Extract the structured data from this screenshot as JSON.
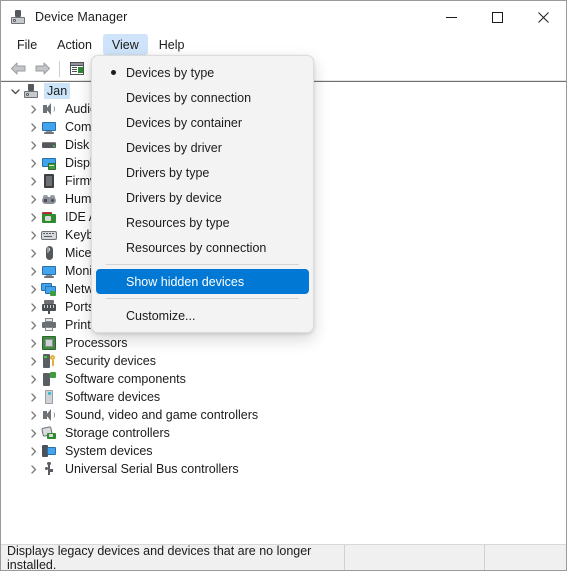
{
  "window": {
    "title": "Device Manager",
    "icon": "device-manager-icon",
    "controls": {
      "minimize": "minimize-icon",
      "maximize": "maximize-icon",
      "close": "close-icon"
    }
  },
  "menubar": {
    "items": [
      {
        "label": "File",
        "active": false
      },
      {
        "label": "Action",
        "active": false
      },
      {
        "label": "View",
        "active": true
      },
      {
        "label": "Help",
        "active": false
      }
    ]
  },
  "toolbar": {
    "buttons": [
      {
        "name": "back-arrow-icon",
        "enabled": false
      },
      {
        "name": "forward-arrow-icon",
        "enabled": false
      },
      {
        "name": "properties-icon",
        "enabled": true
      }
    ]
  },
  "view_menu": {
    "items": [
      {
        "label": "Devices by type",
        "checked": true,
        "highlight": false,
        "separator_after": false
      },
      {
        "label": "Devices by connection",
        "checked": false,
        "highlight": false,
        "separator_after": false
      },
      {
        "label": "Devices by container",
        "checked": false,
        "highlight": false,
        "separator_after": false
      },
      {
        "label": "Devices by driver",
        "checked": false,
        "highlight": false,
        "separator_after": false
      },
      {
        "label": "Drivers by type",
        "checked": false,
        "highlight": false,
        "separator_after": false
      },
      {
        "label": "Drivers by device",
        "checked": false,
        "highlight": false,
        "separator_after": false
      },
      {
        "label": "Resources by type",
        "checked": false,
        "highlight": false,
        "separator_after": false
      },
      {
        "label": "Resources by connection",
        "checked": false,
        "highlight": false,
        "separator_after": true
      },
      {
        "label": "Show hidden devices",
        "checked": false,
        "highlight": true,
        "separator_after": true
      },
      {
        "label": "Customize...",
        "checked": false,
        "highlight": false,
        "separator_after": false
      }
    ]
  },
  "tree": {
    "root": {
      "label": "Jan",
      "icon": "computer-icon",
      "expanded": true,
      "selected": true
    },
    "nodes": [
      {
        "label": "Audio inputs and outputs",
        "icon": "speaker-icon"
      },
      {
        "label": "Computer",
        "icon": "monitor-icon"
      },
      {
        "label": "Disk drives",
        "icon": "disk-drive-icon"
      },
      {
        "label": "Display adapters",
        "icon": "display-adapter-icon"
      },
      {
        "label": "Firmware",
        "icon": "firmware-chip-icon"
      },
      {
        "label": "Human Interface Devices",
        "icon": "gamepad-icon"
      },
      {
        "label": "IDE ATA/ATAPI controllers",
        "icon": "ide-controller-icon"
      },
      {
        "label": "Keyboards",
        "icon": "keyboard-icon"
      },
      {
        "label": "Mice and other pointing devices",
        "icon": "mouse-icon"
      },
      {
        "label": "Monitors",
        "icon": "monitor-icon"
      },
      {
        "label": "Network adapters",
        "icon": "network-adapter-icon"
      },
      {
        "label": "Ports (COM & LPT)",
        "icon": "port-icon"
      },
      {
        "label": "Print queues",
        "icon": "printer-icon"
      },
      {
        "label": "Processors",
        "icon": "processor-icon"
      },
      {
        "label": "Security devices",
        "icon": "security-device-icon"
      },
      {
        "label": "Software components",
        "icon": "software-component-icon"
      },
      {
        "label": "Software devices",
        "icon": "software-device-icon"
      },
      {
        "label": "Sound, video and game controllers",
        "icon": "speaker-icon"
      },
      {
        "label": "Storage controllers",
        "icon": "storage-controller-icon"
      },
      {
        "label": "System devices",
        "icon": "system-device-icon"
      },
      {
        "label": "Universal Serial Bus controllers",
        "icon": "usb-icon"
      }
    ]
  },
  "statusbar": {
    "message": "Displays legacy devices and devices that are no longer installed.",
    "pane2": "",
    "pane3": ""
  },
  "colors": {
    "accent": "#0078d4",
    "selection": "#cce4f7",
    "menu_active": "#cfe4fa",
    "menu_bg": "#f3f3f3",
    "statusbar_bg": "#f0f0f0"
  }
}
